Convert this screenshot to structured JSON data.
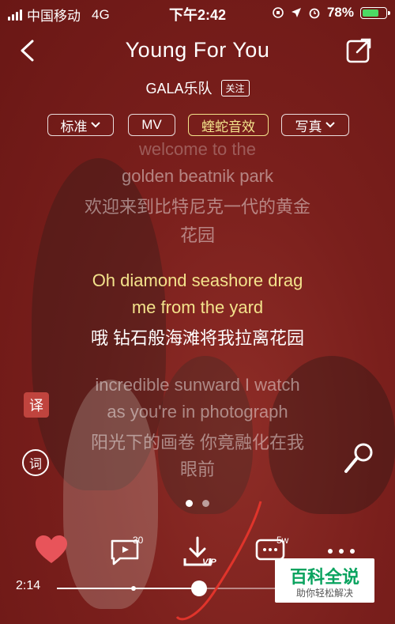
{
  "status_bar": {
    "carrier": "中国移动",
    "network": "4G",
    "time": "下午2:42",
    "battery": "78%",
    "battery_level": 0.78
  },
  "header": {
    "title": "Young For You",
    "artist": "GALA乐队",
    "follow_label": "关注",
    "back_icon": "chevron-left-icon",
    "share_icon": "share-icon"
  },
  "pills": [
    {
      "label": "标准",
      "has_arrow": true
    },
    {
      "label": "MV",
      "has_arrow": false
    },
    {
      "label": "蝰蛇音效",
      "has_arrow": false,
      "active": true
    },
    {
      "label": "写真",
      "has_arrow": true
    }
  ],
  "lyrics": {
    "prev_en_1": "welcome to the",
    "prev_en_2": "golden beatnik park",
    "prev_zh_1": "欢迎来到比特尼克一代的黄金",
    "prev_zh_2": "花园",
    "current_en_1": "Oh diamond seashore drag",
    "current_en_2": "me from the yard",
    "current_zh": "哦 钻石般海滩将我拉离花园",
    "next_en_1": "incredible sunward I watch",
    "next_en_2": "as you're in photograph",
    "next_zh_1": "阳光下的画卷 你竟融化在我",
    "next_zh_2": "眼前"
  },
  "side_controls": {
    "translate_label": "译",
    "lyrics_label": "词"
  },
  "actions": {
    "like_icon": "heart-icon",
    "comment_count": "30",
    "download_badge": "VIP",
    "comment_msg_count": "5w"
  },
  "progress": {
    "current_time": "2:14",
    "fraction": 0.5
  },
  "watermark": {
    "title": "百科全说",
    "subtitle": "助你轻松解决"
  },
  "colors": {
    "accent_yellow": "#f3e28b",
    "heart": "#e8545a",
    "background": "#7a1f1c"
  }
}
